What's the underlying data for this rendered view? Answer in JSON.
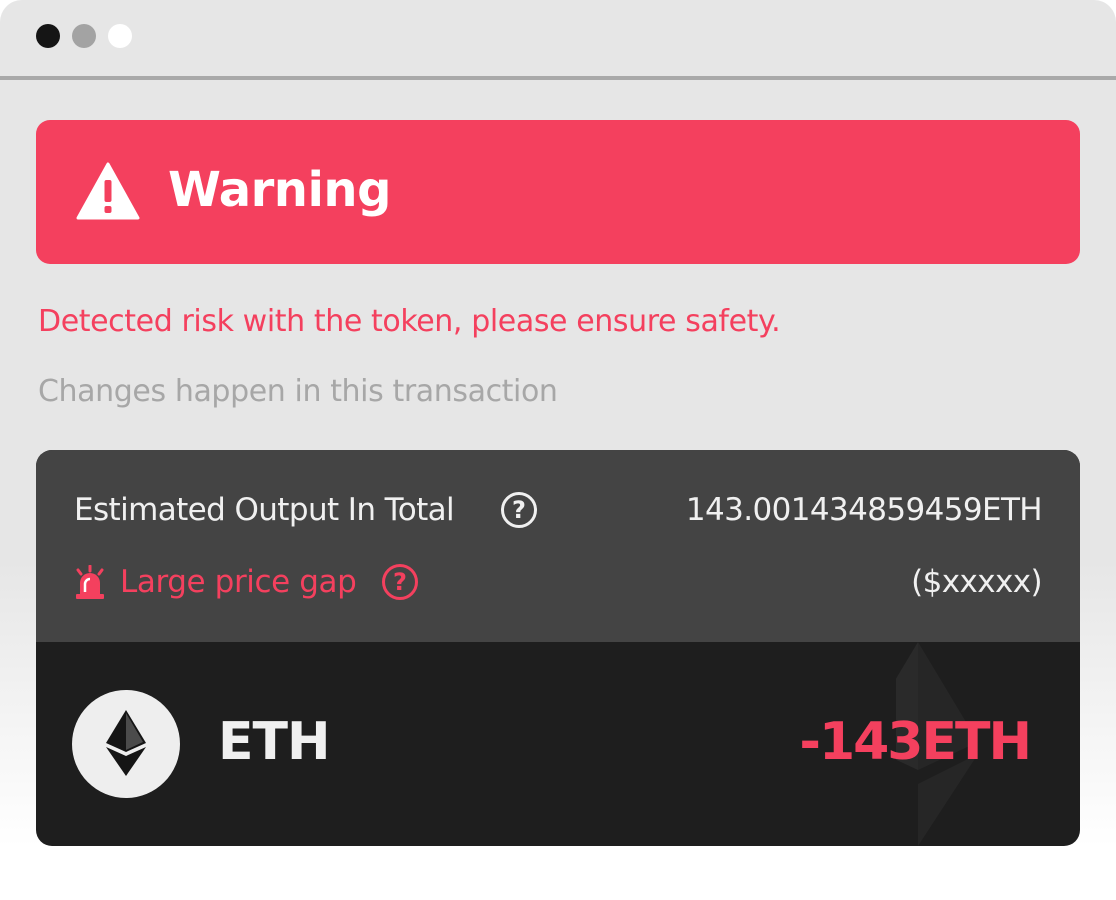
{
  "window": {
    "controls": [
      "close",
      "minimize",
      "maximize"
    ]
  },
  "banner": {
    "title": "Warning",
    "icon": "warning-triangle-icon",
    "color": "#f4405e"
  },
  "messages": {
    "risk": "Detected risk with the token, please ensure safety.",
    "changes_heading": "Changes happen in this transaction"
  },
  "summary": {
    "estimated_label": "Estimated Output In Total",
    "estimated_value": "143.001434859459ETH",
    "help_glyph": "?",
    "gap_label": "Large price gap",
    "gap_icon": "siren-icon",
    "usd_value": "($xxxxx)"
  },
  "token": {
    "icon": "ethereum-icon",
    "name": "ETH",
    "amount": "-143ETH"
  },
  "colors": {
    "accent": "#f4405e",
    "panel_dark": "#444444",
    "panel_darker": "#1e1e1e",
    "background": "#e6e6e6"
  }
}
